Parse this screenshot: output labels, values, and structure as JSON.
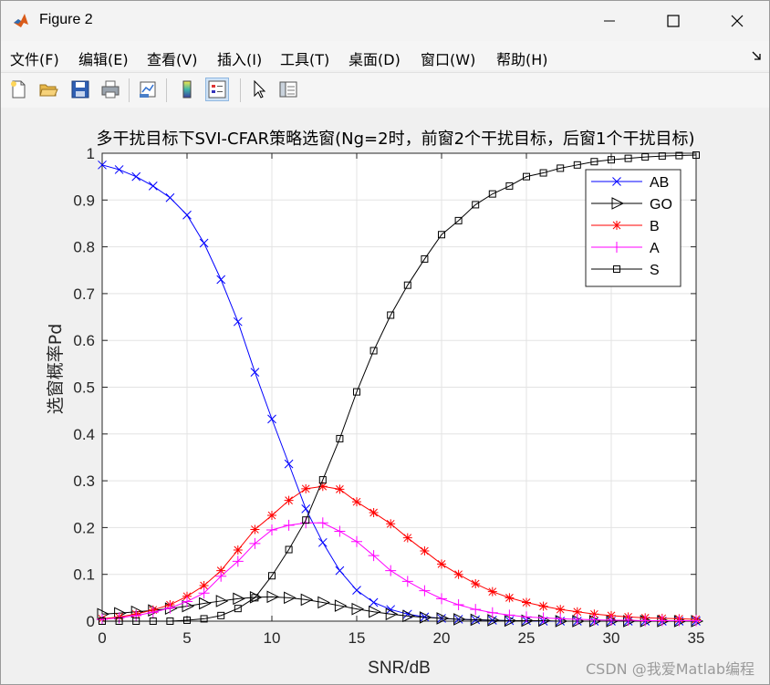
{
  "window": {
    "title": "Figure 2"
  },
  "menu": [
    "文件(F)",
    "编辑(E)",
    "查看(V)",
    "插入(I)",
    "工具(T)",
    "桌面(D)",
    "窗口(W)",
    "帮助(H)"
  ],
  "toolbar": [
    "new-figure",
    "open-file",
    "save",
    "print",
    "link-plot",
    "insert-colorbar",
    "insert-legend",
    "edit-plot",
    "property-inspector"
  ],
  "watermark": "CSDN @我爱Matlab编程",
  "chart_data": {
    "type": "line",
    "title": "多干扰目标下SVI-CFAR策略选窗(Ng=2时，前窗2个干扰目标，后窗1个干扰目标)",
    "xlabel": "SNR/dB",
    "ylabel": "选窗概率Pd",
    "xlim": [
      0,
      35
    ],
    "ylim": [
      0,
      1
    ],
    "xticks": [
      0,
      5,
      10,
      15,
      20,
      25,
      30,
      35
    ],
    "yticks": [
      0,
      0.1,
      0.2,
      0.3,
      0.4,
      0.5,
      0.6,
      0.7,
      0.8,
      0.9,
      1
    ],
    "xtick_labels": [
      "0",
      "5",
      "10",
      "15",
      "20",
      "25",
      "30",
      "35"
    ],
    "ytick_labels": [
      "0",
      "0.1",
      "0.2",
      "0.3",
      "0.4",
      "0.5",
      "0.6",
      "0.7",
      "0.8",
      "0.9",
      "1"
    ],
    "grid": true,
    "legend_position": "top-right",
    "x": [
      0,
      1,
      2,
      3,
      4,
      5,
      6,
      7,
      8,
      9,
      10,
      11,
      12,
      13,
      14,
      15,
      16,
      17,
      18,
      19,
      20,
      21,
      22,
      23,
      24,
      25,
      26,
      27,
      28,
      29,
      30,
      31,
      32,
      33,
      34,
      35
    ],
    "series": [
      {
        "name": "AB",
        "color": "#0000ff",
        "marker": "x",
        "values": [
          0.975,
          0.965,
          0.95,
          0.93,
          0.905,
          0.868,
          0.808,
          0.73,
          0.64,
          0.532,
          0.432,
          0.336,
          0.24,
          0.168,
          0.108,
          0.066,
          0.04,
          0.025,
          0.015,
          0.009,
          0.006,
          0.004,
          0.003,
          0.002,
          0.001,
          0.001,
          0.0,
          0.0,
          0.0,
          0.0,
          0.0,
          0.0,
          0.0,
          0.0,
          0.0,
          0.0
        ]
      },
      {
        "name": "GO",
        "color": "#000000",
        "marker": "triangle-right",
        "values": [
          0.015,
          0.017,
          0.02,
          0.023,
          0.027,
          0.032,
          0.038,
          0.043,
          0.048,
          0.051,
          0.052,
          0.05,
          0.046,
          0.04,
          0.033,
          0.026,
          0.02,
          0.015,
          0.011,
          0.008,
          0.006,
          0.004,
          0.003,
          0.002,
          0.001,
          0.001,
          0.001,
          0.0,
          0.0,
          0.0,
          0.0,
          0.0,
          0.0,
          0.0,
          0.0,
          0.0
        ]
      },
      {
        "name": "B",
        "color": "#ff0000",
        "marker": "star",
        "values": [
          0.005,
          0.009,
          0.015,
          0.024,
          0.035,
          0.053,
          0.076,
          0.108,
          0.152,
          0.196,
          0.226,
          0.258,
          0.283,
          0.288,
          0.282,
          0.255,
          0.232,
          0.208,
          0.178,
          0.15,
          0.122,
          0.1,
          0.08,
          0.063,
          0.05,
          0.04,
          0.032,
          0.025,
          0.02,
          0.015,
          0.012,
          0.009,
          0.007,
          0.006,
          0.005,
          0.004
        ]
      },
      {
        "name": "A",
        "color": "#ff00ff",
        "marker": "plus",
        "values": [
          0.004,
          0.007,
          0.012,
          0.019,
          0.028,
          0.042,
          0.06,
          0.096,
          0.128,
          0.166,
          0.195,
          0.205,
          0.21,
          0.21,
          0.192,
          0.17,
          0.14,
          0.108,
          0.085,
          0.065,
          0.048,
          0.035,
          0.025,
          0.018,
          0.013,
          0.009,
          0.007,
          0.005,
          0.004,
          0.003,
          0.002,
          0.002,
          0.001,
          0.001,
          0.001,
          0.001
        ]
      },
      {
        "name": "S",
        "color": "#000000",
        "marker": "square",
        "values": [
          0.0,
          0.0,
          0.0,
          0.0,
          0.0,
          0.002,
          0.005,
          0.012,
          0.027,
          0.05,
          0.097,
          0.153,
          0.216,
          0.302,
          0.39,
          0.49,
          0.578,
          0.654,
          0.718,
          0.774,
          0.826,
          0.856,
          0.89,
          0.913,
          0.93,
          0.95,
          0.958,
          0.968,
          0.975,
          0.982,
          0.986,
          0.989,
          0.992,
          0.994,
          0.995,
          0.996
        ]
      }
    ]
  }
}
